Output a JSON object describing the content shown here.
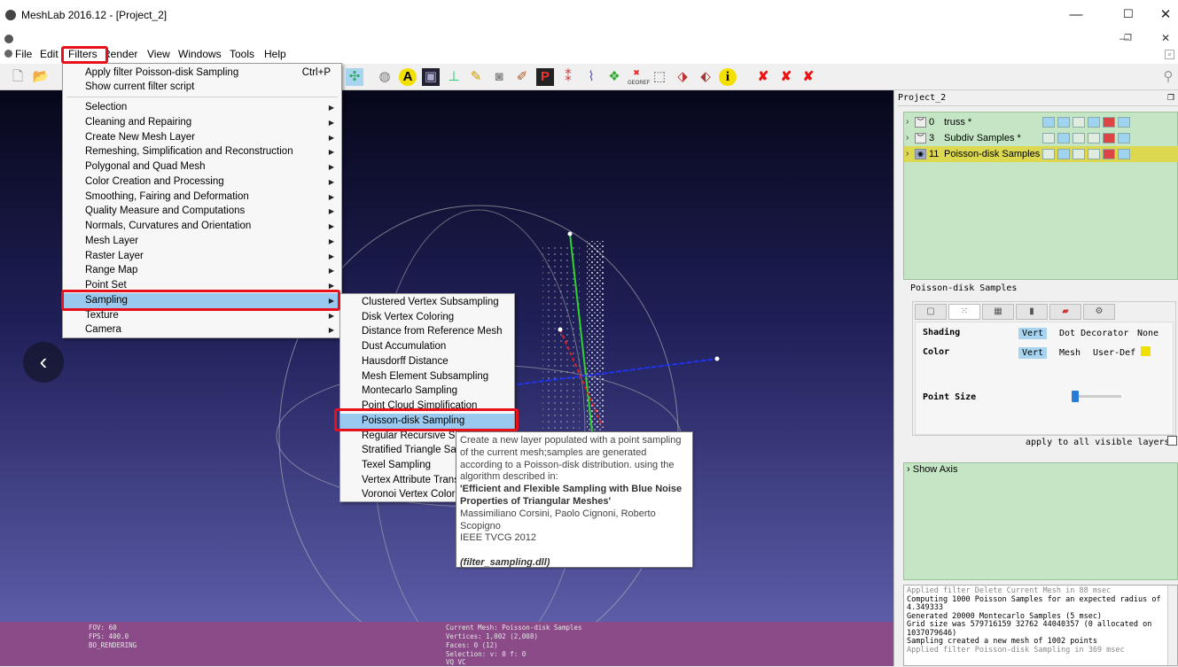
{
  "window": {
    "title": "MeshLab 2016.12 - [Project_2]",
    "minimize": "—",
    "maximize": "☐",
    "close": "✕"
  },
  "menubar": {
    "items": [
      "File",
      "Edit",
      "Filters",
      "Render",
      "View",
      "Windows",
      "Tools",
      "Help"
    ]
  },
  "filters_menu": {
    "top": [
      {
        "label": "Apply filter Poisson-disk Sampling",
        "shortcut": "Ctrl+P"
      },
      {
        "label": "Show current filter script",
        "shortcut": ""
      }
    ],
    "items": [
      "Selection",
      "Cleaning and Repairing",
      "Create New Mesh Layer",
      "Remeshing, Simplification and Reconstruction",
      "Polygonal and Quad Mesh",
      "Color Creation and Processing",
      "Smoothing, Fairing and Deformation",
      "Quality Measure and Computations",
      "Normals, Curvatures and Orientation",
      "Mesh Layer",
      "Raster Layer",
      "Range Map",
      "Point Set",
      "Sampling",
      "Texture",
      "Camera"
    ],
    "highlighted": "Sampling"
  },
  "sampling_submenu": {
    "items": [
      "Clustered Vertex Subsampling",
      "Disk Vertex Coloring",
      "Distance from Reference Mesh",
      "Dust Accumulation",
      "Hausdorff Distance",
      "Mesh Element Subsampling",
      "Montecarlo Sampling",
      "Point Cloud Simplification",
      "Poisson-disk Sampling",
      "Regular Recursive Sampling",
      "Stratified Triangle Sampling",
      "Texel Sampling",
      "Vertex Attribute Transfer",
      "Voronoi Vertex Coloring"
    ],
    "highlighted": "Poisson-disk Sampling"
  },
  "tooltip": {
    "desc": "Create a new layer populated with a point sampling of the current mesh;samples are generated according to a Poisson-disk distribution. using the algorithm described in:",
    "ref_title": "'Efficient and Flexible Sampling with Blue Noise Properties of Triangular Meshes'",
    "authors": "Massimiliano Corsini, Paolo Cignoni, Roberto Scopigno",
    "venue": "IEEE TVCG 2012",
    "dll": "(filter_sampling.dll)"
  },
  "layers": {
    "title": "Project_2",
    "rows": [
      {
        "id": "0",
        "name": "truss *"
      },
      {
        "id": "3",
        "name": "Subdiv Samples *"
      },
      {
        "id": "11",
        "name": "Poisson-disk Samples"
      }
    ]
  },
  "properties": {
    "title": "Poisson-disk Samples",
    "shading_label": "Shading",
    "shading_options": [
      "Vert",
      "Dot Decorator",
      "None"
    ],
    "color_label": "Color",
    "color_options": [
      "Vert",
      "Mesh",
      "User-Def"
    ],
    "color_swatch": "#f0e000",
    "point_size_label": "Point Size",
    "apply_all": "apply to all visible layers"
  },
  "show_axis": "Show Axis",
  "log": [
    "Applied filter Delete Current Mesh in 88 msec",
    "Computing 1000 Poisson Samples for an expected radius of 4.349333",
    "Generated 20000 Montecarlo Samples (5 msec)",
    "Grid size was 579716159 32762 44040357 (0 allocated on 1037079646)",
    "Sampling created a new mesh of 1002 points",
    "Applied filter Poisson-disk Sampling in 369 msec"
  ],
  "status": {
    "fov": "FOV: 60",
    "fps": "FPS:   400.0",
    "mode": "BO_RENDERING",
    "current_mesh": "Current Mesh: Poisson-disk Samples",
    "vertices": "Vertices: 1,002   (2,008)",
    "faces": "Faces: 0    (12)",
    "selection": "Selection: v: 0 f: 0",
    "vq": "VQ VC"
  },
  "nav_icon": "chevron-left-icon"
}
